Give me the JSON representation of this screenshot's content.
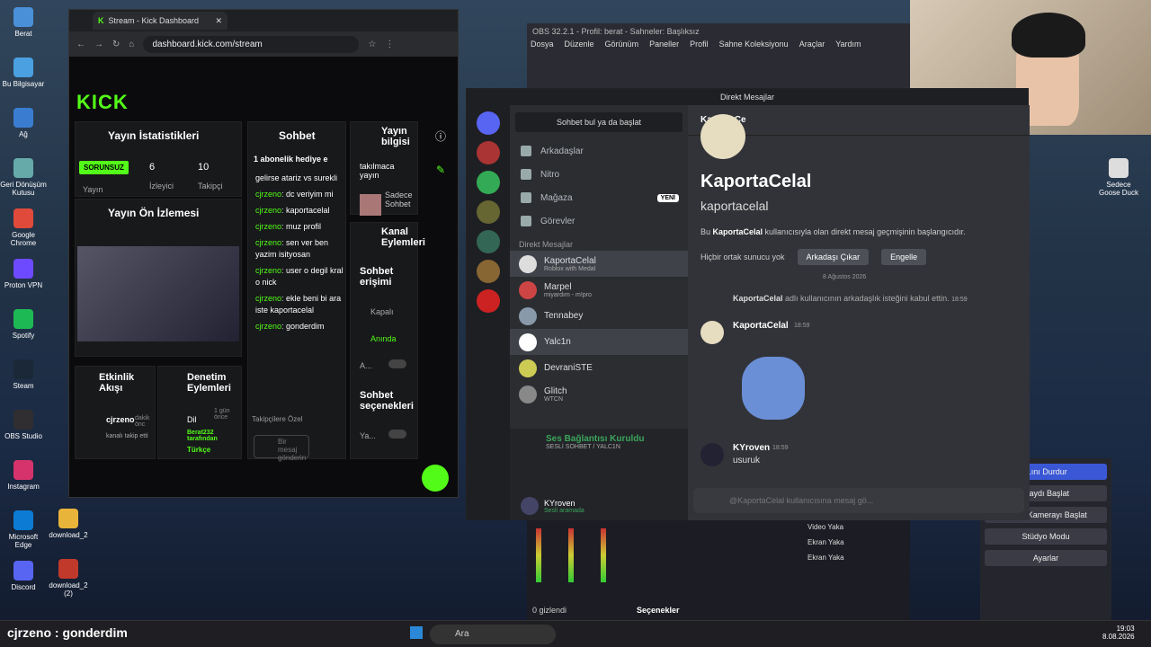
{
  "desktop": {
    "icons": [
      {
        "label": "Berat",
        "color": "#4a90d9"
      },
      {
        "label": "Bu Bilgisayar",
        "color": "#4aa0e0"
      },
      {
        "label": "Ağ",
        "color": "#3a7dd0"
      },
      {
        "label": "Geri Dönüşüm Kutusu",
        "color": "#6aa"
      },
      {
        "label": "Google Chrome",
        "color": "#e04a3a"
      },
      {
        "label": "Proton VPN",
        "color": "#6d4aff"
      },
      {
        "label": "Spotify",
        "color": "#1db954"
      },
      {
        "label": "Steam",
        "color": "#1b2838"
      },
      {
        "label": "OBS Studio",
        "color": "#302e31"
      },
      {
        "label": "Instagram",
        "color": "#d6336c"
      },
      {
        "label": "Microsoft Edge",
        "color": "#0c7bd3"
      },
      {
        "label": "Discord",
        "color": "#5865f2"
      }
    ],
    "icons2": [
      {
        "label": "download_2",
        "color": "#e8b43a"
      },
      {
        "label": "download_2 (2)",
        "color": "#c0392b"
      }
    ],
    "right_icons": [
      {
        "label": "Sedece Goose Duck"
      }
    ]
  },
  "chrome": {
    "tab_title": "Stream - Kick Dashboard",
    "url": "dashboard.kick.com/stream"
  },
  "kick": {
    "logo": "KICK",
    "stats_title": "Yayın İstatistikleri",
    "badge": "SORUNSUZ",
    "viewers": "6",
    "viewers_label": "İzleyici",
    "followers": "10",
    "followers_label": "Takipçi",
    "stream_label": "Yayın",
    "preview_title": "Yayın Ön İzlemesi",
    "activity_title": "Etkinlik Akışı",
    "activity_user": "cjrzeno",
    "activity_time": "dakik önc",
    "activity_text": "kanalı takip etti",
    "mod_title": "Denetim Eylemleri",
    "mod_lang": "Dil",
    "mod_time": "1 gün önce",
    "mod_user": "Berat232 tarafından",
    "mod_value": "Türkçe",
    "chat_title": "Sohbet",
    "chat_pinned": "1 abonelik hediye e",
    "chat_messages": [
      {
        "user": "",
        "text": "gelirse atariz vs surekli"
      },
      {
        "user": "cjrzeno",
        "text": "dc veriyim mi"
      },
      {
        "user": "cjrzeno",
        "text": "kaportacelal"
      },
      {
        "user": "cjrzeno",
        "text": "muz profil"
      },
      {
        "user": "cjrzeno",
        "text": "sen ver ben yazim isityosan"
      },
      {
        "user": "cjrzeno",
        "text": "user o degil kral o nick"
      },
      {
        "user": "cjrzeno",
        "text": "ekle beni bi ara iste kaportacelal"
      },
      {
        "user": "cjrzeno",
        "text": "gonderdim"
      }
    ],
    "chat_footer": "Takipçilere Özel",
    "chat_input": "Bir mesaj gönderin",
    "info_title": "Yayın bilgisi",
    "info_stream": "takılmaca yayın",
    "info_cat": "Sadece Sohbet",
    "actions_title": "Kanal Eylemleri",
    "chat_access": "Sohbet erişimi",
    "kapali": "Kapalı",
    "aninda": "Anında",
    "a_label": "A...",
    "chat_selectors": "Sohbet seçenekleri",
    "ya_label": "Ya..."
  },
  "obs": {
    "title": "OBS 32.2.1 - Profil: berat - Sahneler: Başlıksız",
    "menu": [
      "Dosya",
      "Düzenle",
      "Görünüm",
      "Paneller",
      "Profil",
      "Sahne Koleksiyonu",
      "Araçlar",
      "Yardım"
    ],
    "sources": [
      "Video Yaka",
      "Ekran Yaka",
      "Ekran Yaka"
    ],
    "controls": [
      "...ını Durdur",
      "...aydı Başlat",
      "Sanal Kamerayı Başlat",
      "Stüdyo Modu",
      "Ayarlar"
    ],
    "bottom_label": "Seçenekler",
    "hidden_label": "0 gizlendi"
  },
  "discord": {
    "title": "Direkt Mesajlar",
    "search": "Sohbet bul ya da başlat",
    "nav": [
      {
        "label": "Arkadaşlar",
        "badge": ""
      },
      {
        "label": "Nitro",
        "badge": ""
      },
      {
        "label": "Mağaza",
        "badge": "YENİ"
      },
      {
        "label": "Görevler",
        "badge": ""
      }
    ],
    "dm_header": "Direkt Mesajlar",
    "dms": [
      {
        "name": "KaportaCelal",
        "sub": "Roblox with Medal",
        "color": "#ddd"
      },
      {
        "name": "Marpel",
        "sub": "miyardım - m!pro",
        "color": "#c44"
      },
      {
        "name": "Tennabey",
        "sub": "",
        "color": "#8899aa"
      },
      {
        "name": "Yalc1n",
        "sub": "",
        "color": "#fff"
      },
      {
        "name": "DevraniSTE",
        "sub": "",
        "color": "#cc5"
      },
      {
        "name": "Glitch",
        "sub": "WTCN",
        "color": "#888"
      }
    ],
    "voice_status": "Ses Bağlantısı Kuruldu",
    "voice_channel": "SESLİ SOHBET / YALC1N",
    "user": "KYroven",
    "user_status": "Sesli aramada",
    "profile_name": "KaportaCelal",
    "profile_handle": "kaportacelal",
    "profile_desc_pre": "Bu ",
    "profile_desc_name": "KaportaCelal",
    "profile_desc_post": " kullanıcısıyla olan direkt mesaj geçmişinin başlangıcıdır.",
    "no_server": "Hiçbir ortak sunucu yok",
    "remove_friend": "Arkadaşı Çıkar",
    "block": "Engelle",
    "date": "8 Ağustos 2026",
    "sys_msg_user": "KaportaCelal",
    "sys_msg": " adlı kullanıcının arkadaşlık isteğini kabul ettin.",
    "sys_time": "18:59",
    "messages": [
      {
        "user": "KaportaCelal",
        "time": "18:59",
        "text": ""
      },
      {
        "user": "KYroven",
        "time": "18:59",
        "text": "usuruk"
      }
    ],
    "input_placeholder": "@KaportaCelal kullanıcısına mesaj gö...",
    "header_name": "KaportaCe",
    "header_right": "kap"
  },
  "taskbar": {
    "search": "Ara",
    "time": "19:03",
    "date": "8.08.2026",
    "caption_user": "cjrzeno",
    "caption_text": " : gonderdim"
  }
}
